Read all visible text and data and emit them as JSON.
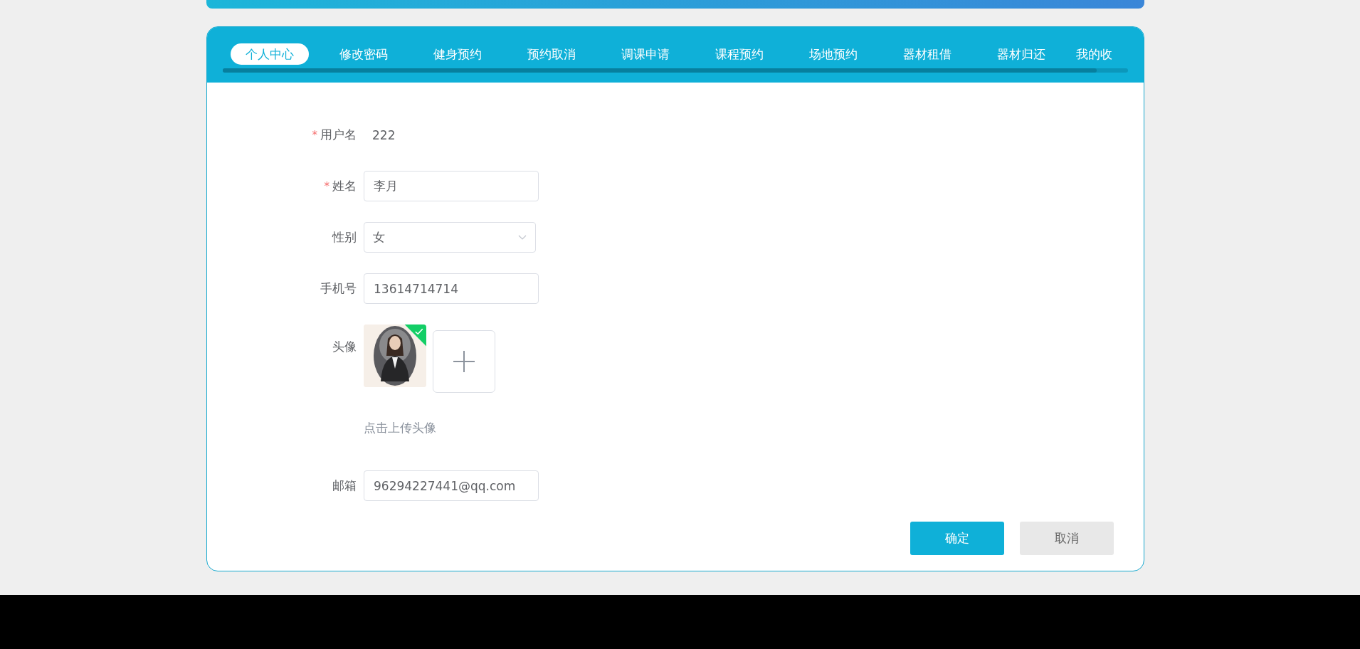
{
  "tabs": [
    {
      "label": "个人中心",
      "selected": true
    },
    {
      "label": "修改密码",
      "selected": false
    },
    {
      "label": "健身预约",
      "selected": false
    },
    {
      "label": "预约取消",
      "selected": false
    },
    {
      "label": "调课申请",
      "selected": false
    },
    {
      "label": "课程预约",
      "selected": false
    },
    {
      "label": "场地预约",
      "selected": false
    },
    {
      "label": "器材租借",
      "selected": false
    },
    {
      "label": "器材归还",
      "selected": false
    },
    {
      "label": "我的收",
      "selected": false
    }
  ],
  "form": [
    {
      "kind": "text",
      "mark": "*",
      "label": "用户名",
      "value": "222"
    },
    {
      "kind": "input",
      "mark": "*",
      "label": "姓名",
      "value": "李月"
    },
    {
      "kind": "select",
      "label": "性别",
      "value": "女"
    },
    {
      "kind": "input",
      "label": "手机号",
      "value": "13614714714"
    },
    {
      "kind": "upload",
      "label": "头像",
      "uploaded": true,
      "hint": "点击上传头像"
    },
    {
      "kind": "input",
      "label": "邮箱",
      "value": "96294227441@qq.com"
    }
  ],
  "buttons": [
    {
      "label": "确定",
      "kind": "primary"
    },
    {
      "label": "取消",
      "kind": "secondary"
    }
  ]
}
